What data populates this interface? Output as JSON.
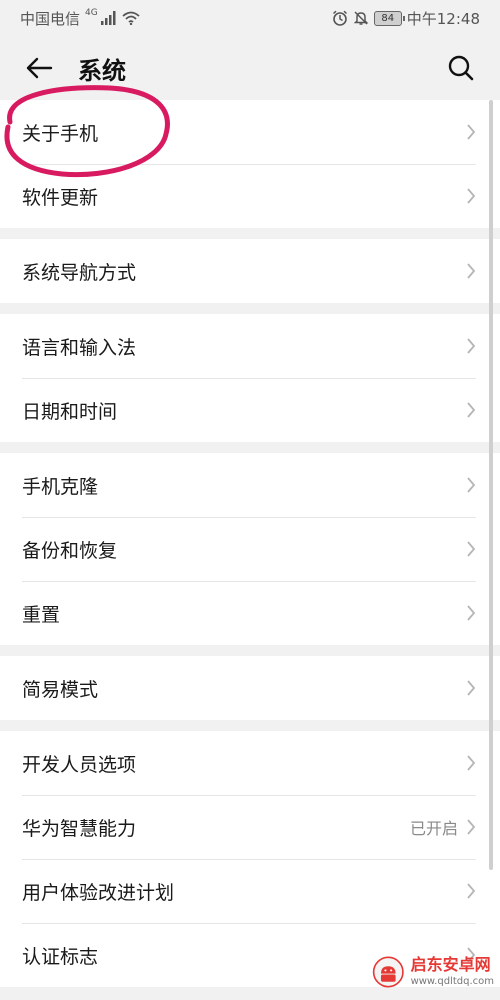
{
  "status_bar": {
    "carrier": "中国电信",
    "network": "4G",
    "battery": "84",
    "time": "中午12:48"
  },
  "app_bar": {
    "title": "系统"
  },
  "groups": [
    {
      "items": [
        {
          "label": "关于手机"
        },
        {
          "label": "软件更新"
        }
      ]
    },
    {
      "items": [
        {
          "label": "系统导航方式"
        }
      ]
    },
    {
      "items": [
        {
          "label": "语言和输入法"
        },
        {
          "label": "日期和时间"
        }
      ]
    },
    {
      "items": [
        {
          "label": "手机克隆"
        },
        {
          "label": "备份和恢复"
        },
        {
          "label": "重置"
        }
      ]
    },
    {
      "items": [
        {
          "label": "简易模式"
        }
      ]
    },
    {
      "items": [
        {
          "label": "开发人员选项"
        },
        {
          "label": "华为智慧能力",
          "value": "已开启"
        },
        {
          "label": "用户体验改进计划"
        },
        {
          "label": "认证标志"
        }
      ]
    }
  ],
  "watermark": {
    "name": "启东安卓网",
    "url": "www.qdltdq.com"
  },
  "colors": {
    "annotation": "#d81b60",
    "watermark": "#e53935"
  }
}
